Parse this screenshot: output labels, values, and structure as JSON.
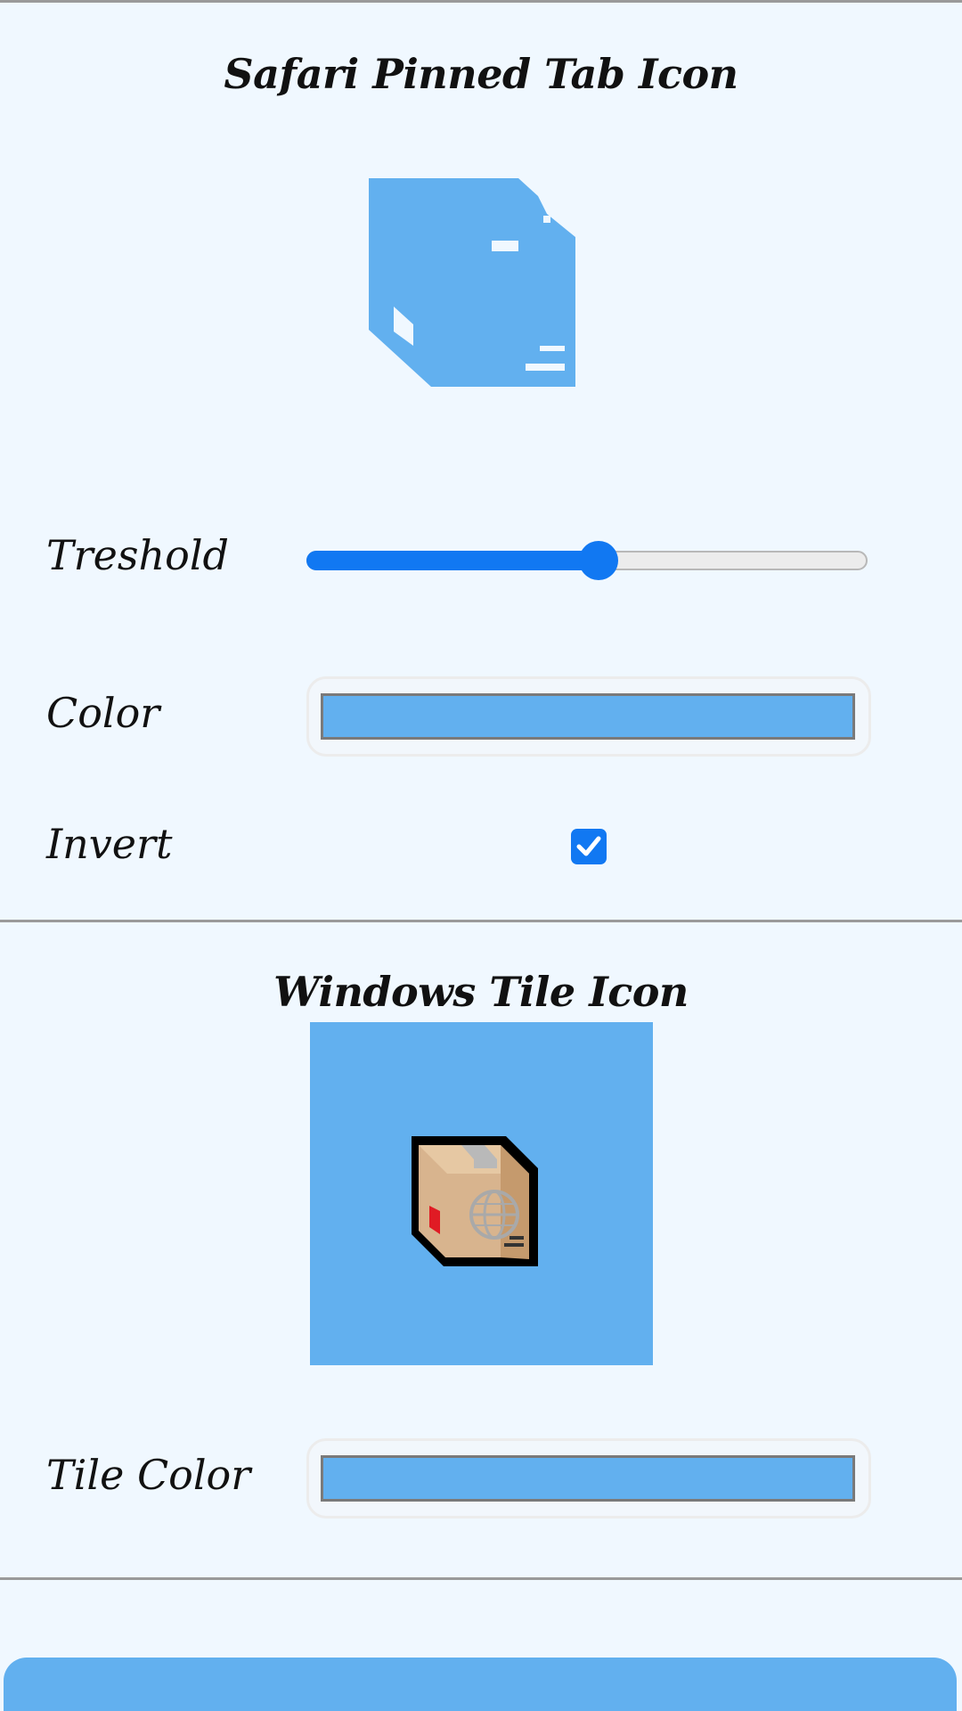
{
  "pinned": {
    "title": "Safari Pinned Tab Icon",
    "icon_name": "package-silhouette-icon",
    "threshold_label": "Treshold",
    "threshold_value": 0.52,
    "color_label": "Color",
    "color_value": "#62b0ef",
    "invert_label": "Invert",
    "invert_checked": true
  },
  "tile": {
    "title": "Windows Tile Icon",
    "icon_name": "package-box-icon",
    "tile_color_label": "Tile Color",
    "tile_color_value": "#62b0ef"
  },
  "colors": {
    "accent": "#1178f2",
    "background": "#f0f8ff",
    "swatch": "#62b0ef"
  }
}
